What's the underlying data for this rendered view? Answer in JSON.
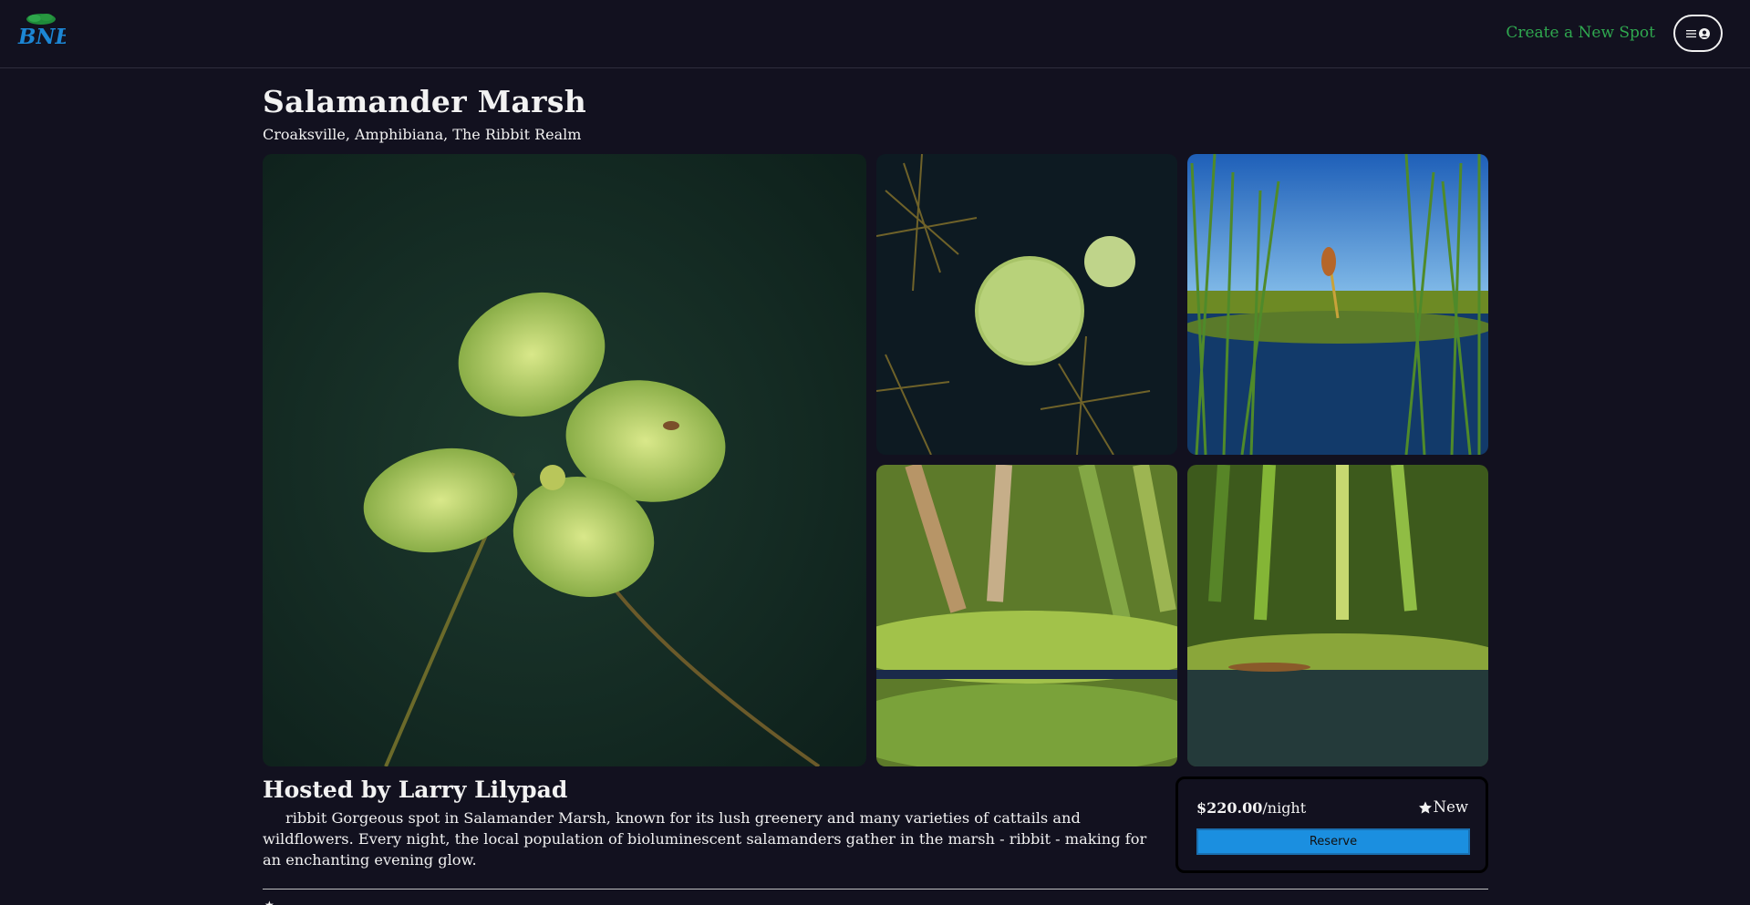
{
  "header": {
    "logo_text": "BNB",
    "create_link": "Create a New Spot",
    "menu_icon": "hamburger-icon",
    "user_icon": "user-circle-icon"
  },
  "spot": {
    "title": "Salamander Marsh",
    "location": "Croaksville, Amphibiana, The Ribbit Realm",
    "host": "Hosted by Larry Lilypad",
    "description": "ribbit Gorgeous spot in Salamander Marsh, known for its lush greenery and many varieties of cattails and wildflowers. Every night, the local population of bioluminescent salamanders gather in the marsh - ribbit - making for an enchanting evening glow."
  },
  "booking": {
    "price": "$220.00",
    "per_night": "/night",
    "rating": "New",
    "reserve_label": "Reserve"
  },
  "colors": {
    "background": "#12111f",
    "accent_green": "#2fa84f",
    "reserve_blue": "#1b8fe0"
  }
}
